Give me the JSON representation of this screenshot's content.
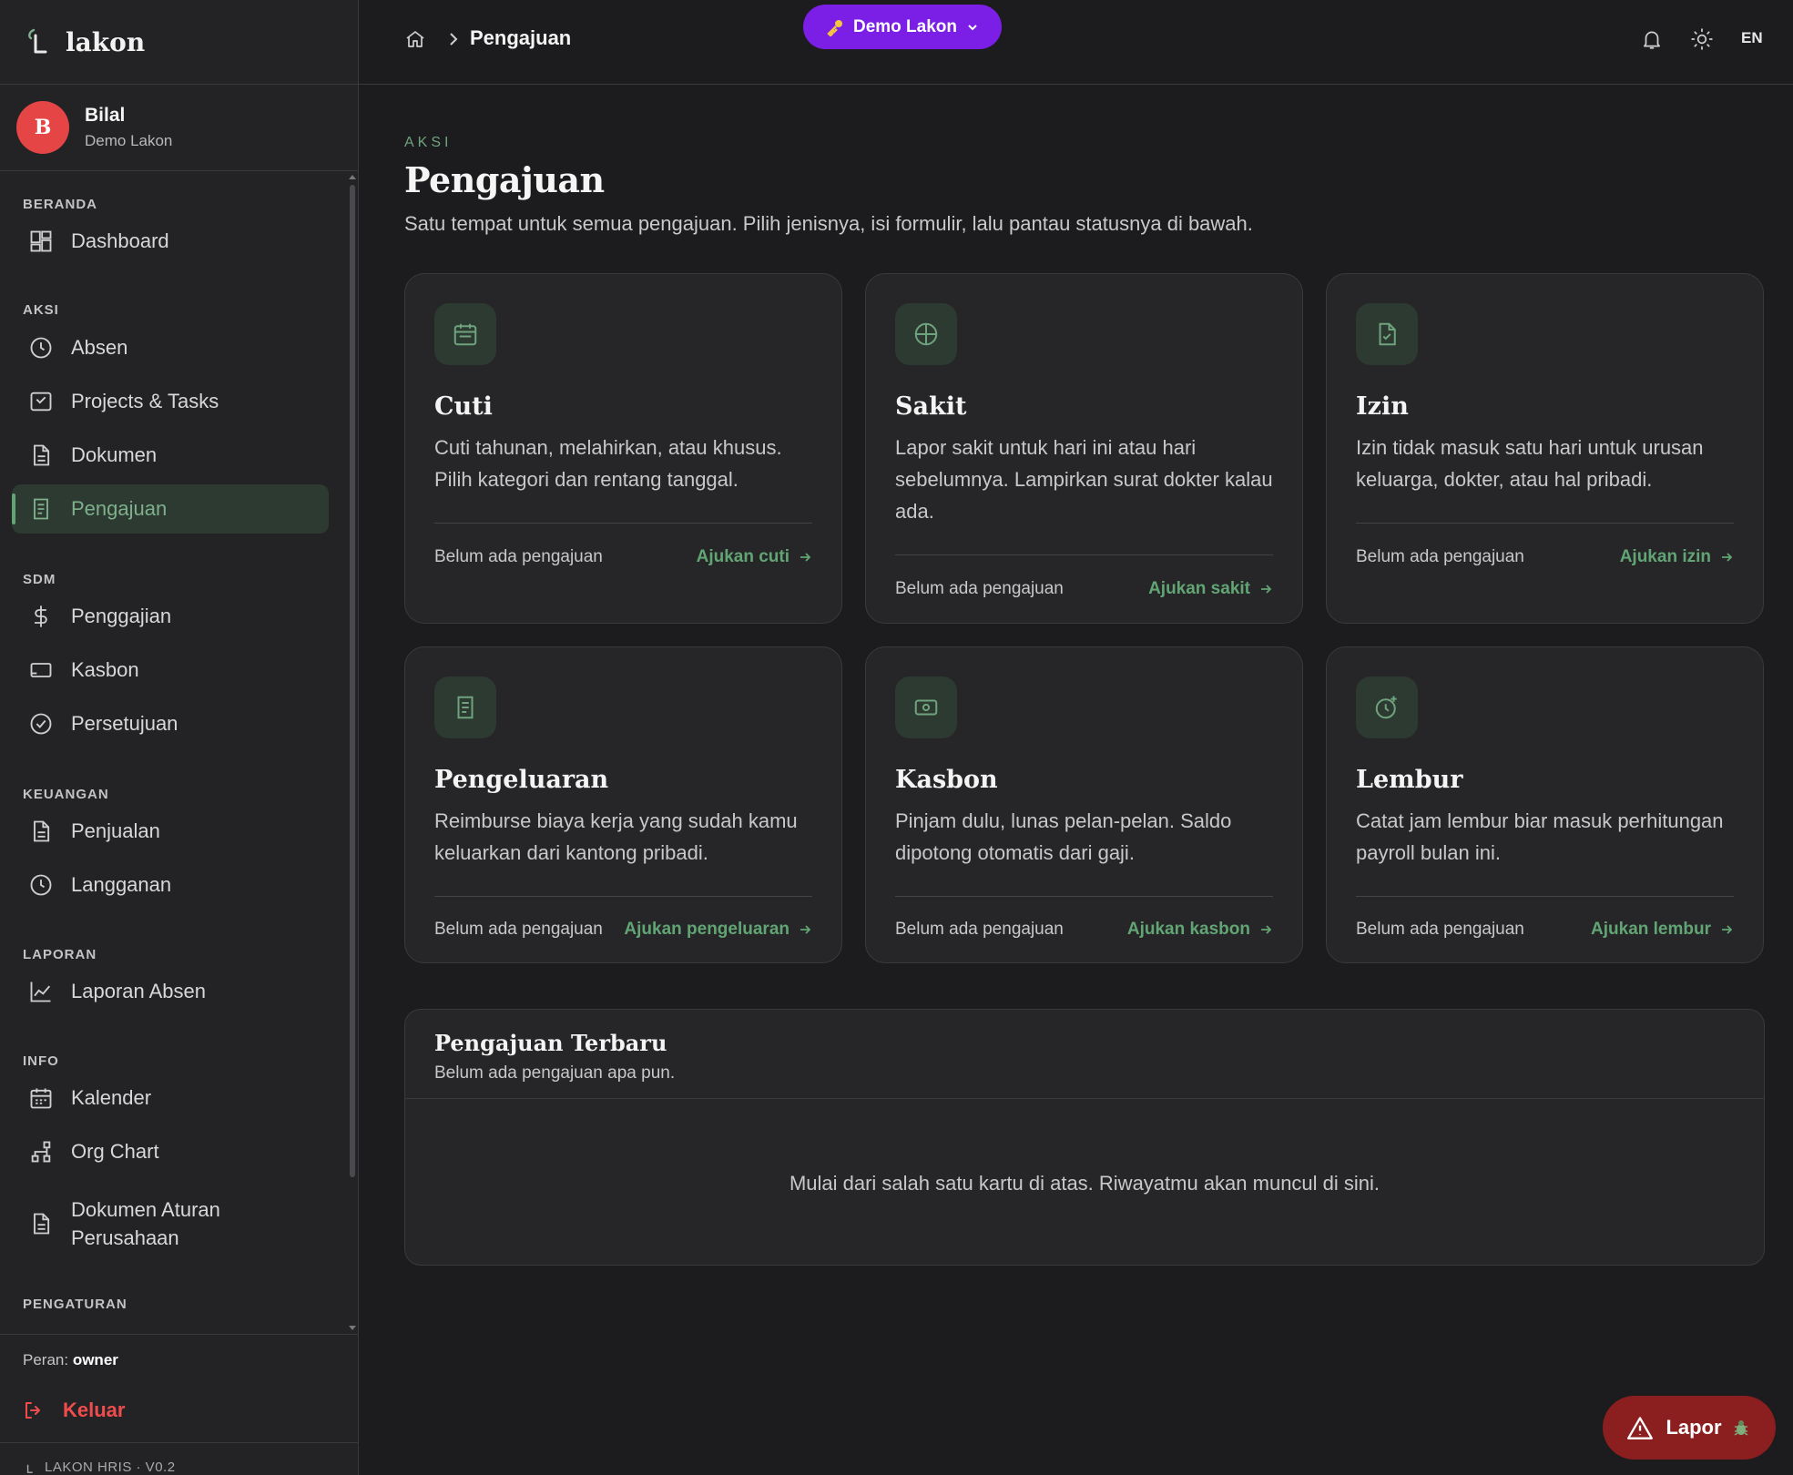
{
  "brand": {
    "name": "lakon"
  },
  "user": {
    "initial": "B",
    "name": "Bilal",
    "org": "Demo Lakon"
  },
  "sidebar": {
    "sections": {
      "beranda": "BERANDA",
      "aksi": "AKSI",
      "sdm": "SDM",
      "keuangan": "KEUANGAN",
      "laporan": "LAPORAN",
      "info": "INFO",
      "pengaturan": "PENGATURAN"
    },
    "items": {
      "dashboard": "Dashboard",
      "absen": "Absen",
      "projects": "Projects & Tasks",
      "dokumen": "Dokumen",
      "pengajuan": "Pengajuan",
      "penggajian": "Penggajian",
      "kasbon": "Kasbon",
      "persetujuan": "Persetujuan",
      "penjualan": "Penjualan",
      "langganan": "Langganan",
      "laporan_absen": "Laporan Absen",
      "kalender": "Kalender",
      "org_chart": "Org Chart",
      "dokumen_aturan_1": "Dokumen Aturan",
      "dokumen_aturan_2": "Perusahaan"
    },
    "active": "pengajuan",
    "role_label": "Peran:",
    "role_value": "owner",
    "logout": "Keluar",
    "version": "LAKON HRIS · V0.2"
  },
  "header": {
    "breadcrumb": "Pengajuan",
    "tenant": "Demo Lakon",
    "lang": "EN"
  },
  "page": {
    "eyebrow": "AKSI",
    "title": "Pengajuan",
    "subtitle": "Satu tempat untuk semua pengajuan. Pilih jenisnya, isi formulir, lalu pantau statusnya di bawah."
  },
  "cards": [
    {
      "icon": "calendar-icon",
      "title": "Cuti",
      "desc": "Cuti tahunan, melahirkan, atau khusus. Pilih kategori dan rentang tanggal.",
      "status": "Belum ada pengajuan",
      "action": "Ajukan cuti"
    },
    {
      "icon": "medical-cross-icon",
      "title": "Sakit",
      "desc": "Lapor sakit untuk hari ini atau hari sebelumnya. Lampirkan surat dokter kalau ada.",
      "status": "Belum ada pengajuan",
      "action": "Ajukan sakit"
    },
    {
      "icon": "document-check-icon",
      "title": "Izin",
      "desc": "Izin tidak masuk satu hari untuk urusan keluarga, dokter, atau hal pribadi.",
      "status": "Belum ada pengajuan",
      "action": "Ajukan izin"
    },
    {
      "icon": "receipt-icon",
      "title": "Pengeluaran",
      "desc": "Reimburse biaya kerja yang sudah kamu keluarkan dari kantong pribadi.",
      "status": "Belum ada pengajuan",
      "action": "Ajukan pengeluaran"
    },
    {
      "icon": "banknote-icon",
      "title": "Kasbon",
      "desc": "Pinjam dulu, lunas pelan-pelan. Saldo dipotong otomatis dari gaji.",
      "status": "Belum ada pengajuan",
      "action": "Ajukan kasbon"
    },
    {
      "icon": "clock-plus-icon",
      "title": "Lembur",
      "desc": "Catat jam lembur biar masuk perhitungan payroll bulan ini.",
      "status": "Belum ada pengajuan",
      "action": "Ajukan lembur"
    }
  ],
  "recent": {
    "title": "Pengajuan Terbaru",
    "subtitle": "Belum ada pengajuan apa pun.",
    "empty": "Mulai dari salah satu kartu di atas. Riwayatmu akan muncul di sini."
  },
  "report_button": "Lapor",
  "colors": {
    "accent_green": "#62a574",
    "tenant_purple": "#7c1fe6",
    "danger_red": "#ef4d4d",
    "report_bg": "#8b1e1e"
  }
}
